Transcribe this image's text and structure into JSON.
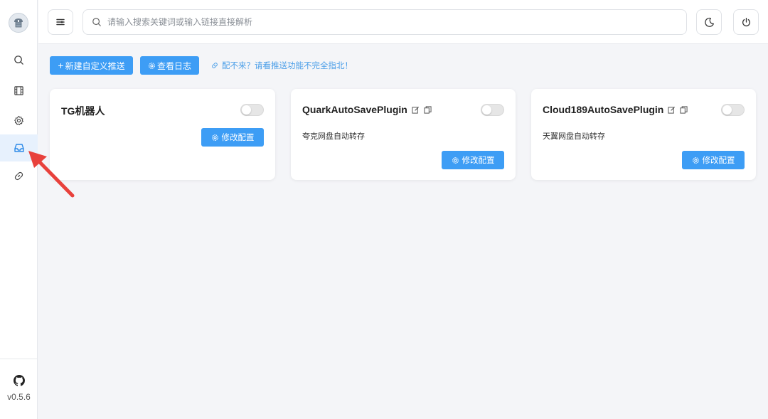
{
  "sidebar": {
    "logo_icon": "server-cloud-logo-icon",
    "items": [
      {
        "icon": "search-icon",
        "active": false
      },
      {
        "icon": "film-icon",
        "active": false
      },
      {
        "icon": "gear-icon",
        "active": false
      },
      {
        "icon": "inbox-icon",
        "active": true
      },
      {
        "icon": "link-icon",
        "active": false
      }
    ],
    "github_icon": "github-icon",
    "version": "v0.5.6"
  },
  "header": {
    "menu_icon": "menu-icon",
    "search": {
      "placeholder": "请输入搜索关键词或输入链接直接解析",
      "value": ""
    },
    "theme_icon": "moon-icon",
    "power_icon": "power-icon"
  },
  "toolbar": {
    "new_push_label": "新建自定义推送",
    "view_logs_label": "查看日志",
    "help_link_label": "配不来？请看推送功能不完全指北！"
  },
  "cards": [
    {
      "title": "TG机器人",
      "description": "",
      "has_actions": false,
      "enabled": false,
      "config_label": "修改配置"
    },
    {
      "title": "QuarkAutoSavePlugin",
      "description": "夸克网盘自动转存",
      "has_actions": true,
      "enabled": false,
      "config_label": "修改配置"
    },
    {
      "title": "Cloud189AutoSavePlugin",
      "description": "天翼网盘自动转存",
      "has_actions": true,
      "enabled": false,
      "config_label": "修改配置"
    }
  ],
  "colors": {
    "primary": "#3d9df5",
    "link": "#4a9ee8",
    "background": "#f4f5f8",
    "active_nav": "#e7f1fd",
    "annotation_arrow": "#e8413c"
  }
}
